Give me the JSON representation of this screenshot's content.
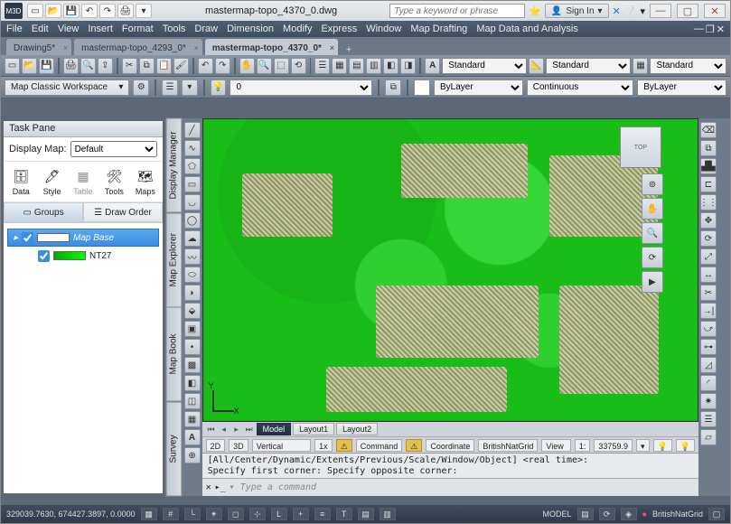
{
  "title": "mastermap-topo_4370_0.dwg",
  "search_placeholder": "Type a keyword or phrase",
  "signin": "Sign In",
  "menu": [
    "File",
    "Edit",
    "View",
    "Insert",
    "Format",
    "Tools",
    "Draw",
    "Dimension",
    "Modify",
    "Express",
    "Window",
    "Map Drafting",
    "Map Data and Analysis"
  ],
  "tabs": [
    {
      "label": "Drawing5*",
      "active": false
    },
    {
      "label": "mastermap-topo_4293_0*",
      "active": false
    },
    {
      "label": "mastermap-topo_4370_0*",
      "active": true
    }
  ],
  "sel_standard": "Standard",
  "layer_value": "0",
  "color": "ByLayer",
  "linetype": "Continuous",
  "lweight": "ByLayer",
  "workspace": "Map Classic Workspace",
  "task_pane_title": "Task Pane",
  "display_map": "Display Map:",
  "display_map_value": "Default",
  "tp_icons": [
    {
      "label": "Data",
      "glyph": "🗄"
    },
    {
      "label": "Style",
      "glyph": "🖊"
    },
    {
      "label": "Table",
      "glyph": "▦"
    },
    {
      "label": "Tools",
      "glyph": "🛠"
    },
    {
      "label": "Maps",
      "glyph": "🗺"
    }
  ],
  "tp_tabs": {
    "groups": "Groups",
    "draw_order": "Draw Order"
  },
  "layers": [
    {
      "name": "Map Base",
      "color": "#ffffff",
      "active": true
    },
    {
      "name": "NT27",
      "color": "#00ff00",
      "active": false
    }
  ],
  "side_tabs": [
    "Display Manager",
    "Map Explorer",
    "Map Book",
    "Survey"
  ],
  "ucs": {
    "x": "X",
    "y": "Y"
  },
  "layout_tabs": {
    "model": "Model",
    "l1": "Layout1",
    "l2": "Layout2"
  },
  "status": {
    "d2": "2D",
    "d3": "3D",
    "vex": "Vertical Exaggeration:",
    "vex_v": "1x",
    "cmd": "Command",
    "cs": "Coordinate System:",
    "cs_v": "BritishNatGrid",
    "vs": "View Scale",
    "vs_sep": "1:",
    "vs_v": "33759.9"
  },
  "cmd_hist": "[All/Center/Dynamic/Extents/Previous/Scale/Window/Object] <real time>:\nSpecify first corner: Specify opposite corner:",
  "cmd_prompt": "Type a command",
  "bottom": {
    "coords": "329039.7630, 674427.3897, 0.0000",
    "model": "MODEL",
    "bng": "BritishNatGrid"
  }
}
